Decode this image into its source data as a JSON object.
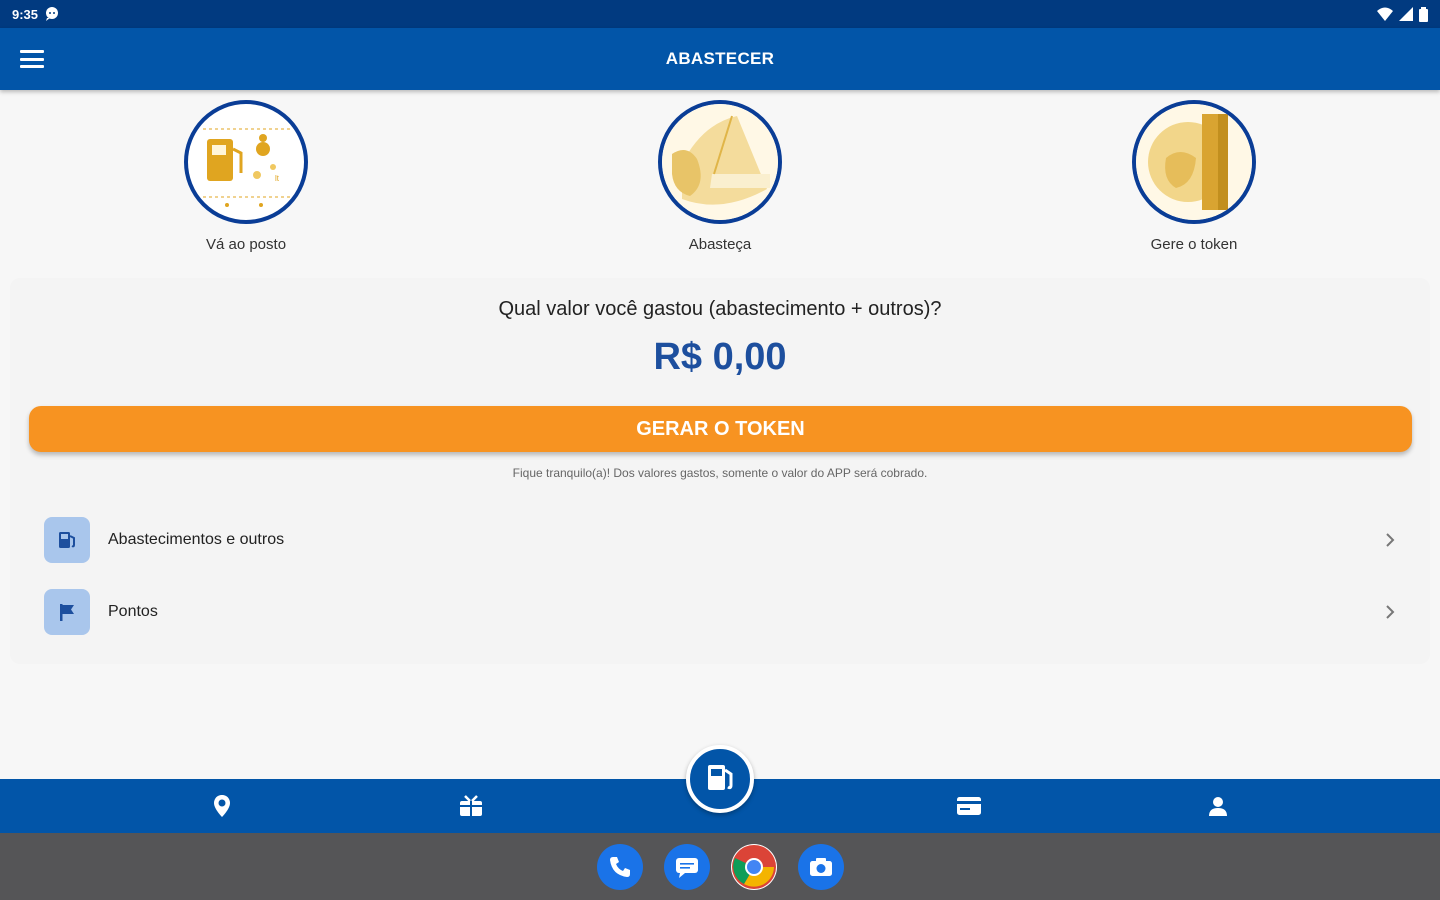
{
  "status_bar": {
    "time": "9:35"
  },
  "app_bar": {
    "title": "ABASTECER"
  },
  "steps": [
    {
      "label": "Vá ao posto"
    },
    {
      "label": "Abasteça"
    },
    {
      "label": "Gere o token"
    }
  ],
  "card": {
    "question": "Qual valor você gastou (abastecimento + outros)?",
    "amount": "R$ 0,00",
    "button_label": "GERAR O TOKEN",
    "note": "Fique tranquilo(a)! Dos valores gastos, somente o valor do APP será cobrado.",
    "items": [
      {
        "label": "Abastecimentos e outros",
        "icon": "fuel-pump-icon"
      },
      {
        "label": "Pontos",
        "icon": "flag-icon"
      }
    ]
  },
  "bottom_nav": {
    "items": [
      "location-pin-icon",
      "gift-icon",
      "fuel-pump-icon",
      "card-icon",
      "profile-icon"
    ]
  },
  "dock": {
    "apps": [
      "phone-icon",
      "messages-icon",
      "chrome-icon",
      "camera-icon"
    ]
  },
  "colors": {
    "primary": "#0255a8",
    "status": "#013a80",
    "accent": "#f79321",
    "amount": "#1d4f9e",
    "illustration": "#e0a520"
  }
}
